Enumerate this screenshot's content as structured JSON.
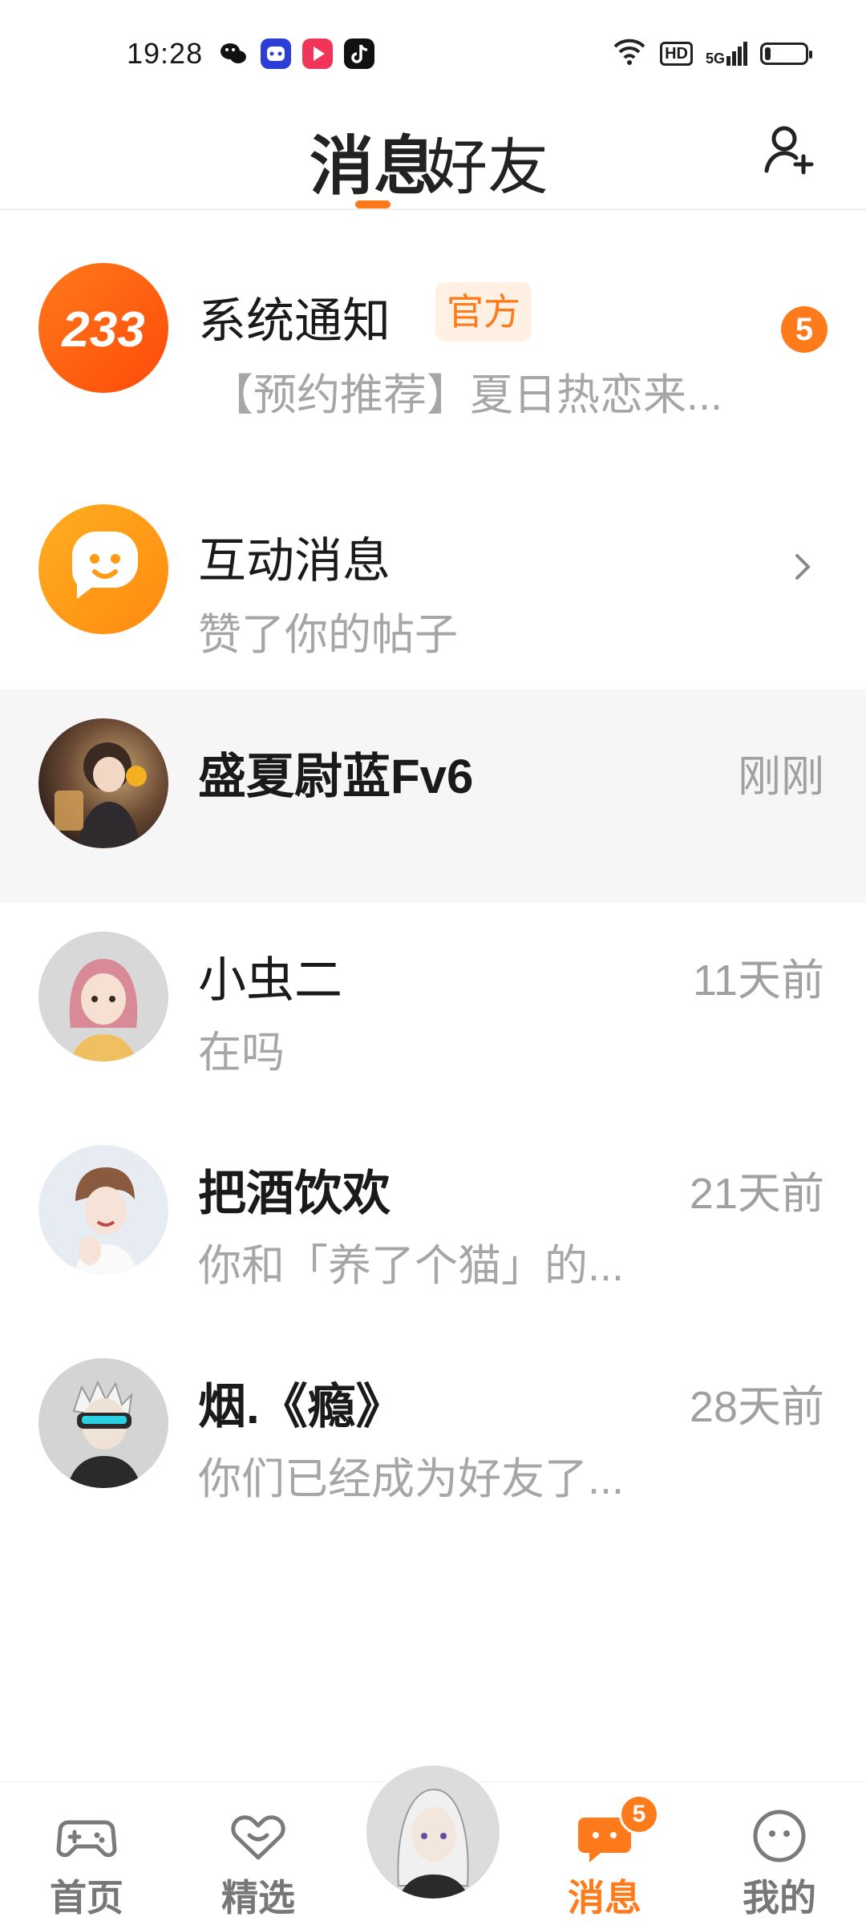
{
  "status_bar": {
    "time": "19:28",
    "apps": [
      "wechat-icon",
      "assistant-icon",
      "video-icon",
      "tiktok-icon"
    ],
    "hd": "HD",
    "network": "5G",
    "battery_level": 0.15
  },
  "header": {
    "tabs": [
      {
        "label": "消息",
        "active": true
      },
      {
        "label": "好友",
        "active": false
      }
    ],
    "add_friend_icon": "add-user-icon"
  },
  "messages": [
    {
      "type": "system",
      "title": "系统通知",
      "badge": "官方",
      "preview": "【预约推荐】夏日热恋来...",
      "unread": "5",
      "avatar_text": "233"
    },
    {
      "type": "interaction",
      "title": "互动消息",
      "preview": "赞了你的帖子"
    },
    {
      "type": "chat",
      "title": "盛夏尉蓝Fv6",
      "preview": "",
      "time": "刚刚"
    },
    {
      "type": "chat",
      "title": "小虫二",
      "preview": "在吗",
      "time": "11天前"
    },
    {
      "type": "chat",
      "title": "把酒饮欢",
      "preview": "你和「养了个猫」的...",
      "time": "21天前"
    },
    {
      "type": "chat",
      "title": "烟.《瘾》",
      "preview": "你们已经成为好友了...",
      "time": "28天前"
    }
  ],
  "bottom_nav": {
    "items": [
      {
        "label": "首页",
        "icon": "gamepad-icon"
      },
      {
        "label": "精选",
        "icon": "heart-icon"
      },
      {
        "label": "",
        "icon": "avatar"
      },
      {
        "label": "消息",
        "icon": "chat-bubble-icon",
        "badge": "5",
        "active": true
      },
      {
        "label": "我的",
        "icon": "face-icon"
      }
    ]
  },
  "colors": {
    "accent": "#ff7a1a",
    "text_primary": "#1a1a1a",
    "text_secondary": "#a6a6a6"
  }
}
